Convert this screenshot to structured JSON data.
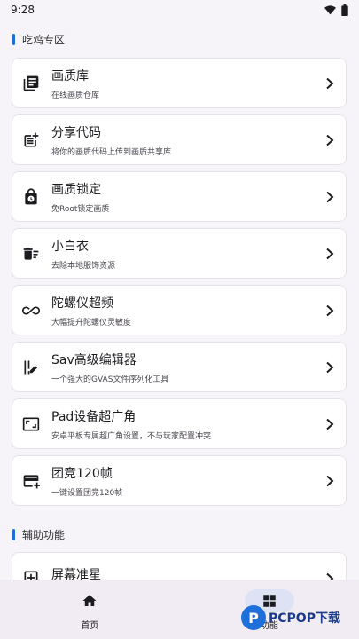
{
  "status_bar": {
    "time": "9:28"
  },
  "sections": [
    {
      "title": "吃鸡专区"
    },
    {
      "title": "辅助功能"
    }
  ],
  "items": [
    {
      "icon": "library-icon",
      "title": "画质库",
      "subtitle": "在线画质仓库"
    },
    {
      "icon": "post-add-icon",
      "title": "分享代码",
      "subtitle": "将你的画质代码上传到画质共享库"
    },
    {
      "icon": "lock-clock-icon",
      "title": "画质锁定",
      "subtitle": "免Root锁定画质"
    },
    {
      "icon": "delete-sweep-icon",
      "title": "小白衣",
      "subtitle": "去除本地服饰资源"
    },
    {
      "icon": "infinity-icon",
      "title": "陀螺仪超频",
      "subtitle": "大幅提升陀螺仪灵敏度"
    },
    {
      "icon": "edit-attributes-icon",
      "title": "Sav高级编辑器",
      "subtitle": "一个强大的GVAS文件序列化工具"
    },
    {
      "icon": "aspect-ratio-icon",
      "title": "Pad设备超广角",
      "subtitle": "安卓平板专属超广角设置，不与玩家配置冲突"
    },
    {
      "icon": "payment-card-icon",
      "title": "团竞120帧",
      "subtitle": "一键设置团竞120帧"
    },
    {
      "icon": "crosshair-box-icon",
      "title": "屏幕准星",
      "subtitle": ""
    }
  ],
  "bottom_nav": [
    {
      "label": "首页",
      "icon": "home-icon"
    },
    {
      "label": "功能",
      "icon": "grid-icon"
    }
  ],
  "watermark": {
    "text": "PCPOP下载"
  },
  "colors": {
    "accent": "#1e6fd9",
    "nav_pill": "#dde3f5"
  }
}
